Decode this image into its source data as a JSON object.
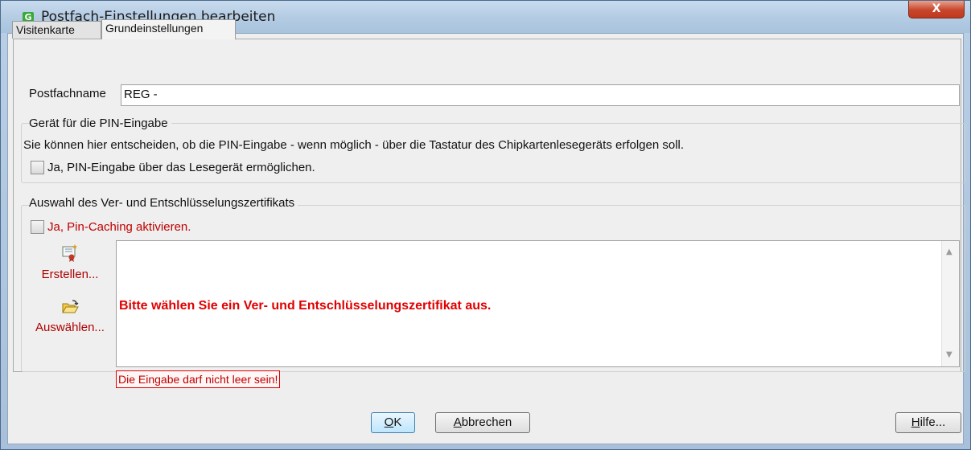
{
  "window": {
    "title": "Postfach-Einstellungen bearbeiten",
    "close_glyph": "X",
    "app_icon_glyph": "G"
  },
  "tabs": [
    {
      "label": "Visitenkarte",
      "active": false
    },
    {
      "label": "Grundeinstellungen",
      "active": true
    }
  ],
  "postfach": {
    "label": "Postfachname",
    "value": "REG -"
  },
  "pin_group": {
    "title": "Gerät für die PIN-Eingabe",
    "description": "Sie können hier entscheiden, ob die PIN-Eingabe - wenn möglich - über die Tastatur des Chipkartenlesegeräts erfolgen soll.",
    "checkbox_label": "Ja, PIN-Eingabe über das Lesegerät ermöglichen.",
    "checked": false
  },
  "cert_group": {
    "title": "Auswahl des Ver- und Entschlüsselungszertifikats",
    "caching_label": "Ja, Pin-Caching aktivieren.",
    "caching_checked": false,
    "create_label": "Erstellen...",
    "create_icon": "new-certificate-icon",
    "select_label": "Auswählen...",
    "select_icon": "open-folder-icon",
    "message": "Bitte wählen Sie ein Ver- und Entschlüsselungszertifikat aus.",
    "error": "Die Eingabe darf nicht leer sein!"
  },
  "buttons": {
    "ok_mnemonic": "O",
    "ok_rest": "K",
    "cancel_mnemonic": "A",
    "cancel_rest": "bbrechen",
    "help_mnemonic": "H",
    "help_rest": "ilfe..."
  },
  "colors": {
    "error_red": "#e00000",
    "label_red": "#c00000",
    "title_bar": "#b3cbe3",
    "close_button": "#c7452b"
  }
}
